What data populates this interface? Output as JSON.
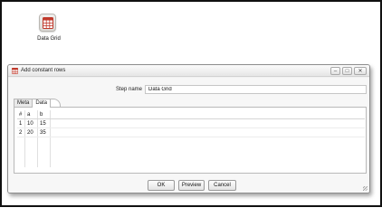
{
  "canvas": {
    "step_label": "Data Grid",
    "step_icon": "data-grid-icon"
  },
  "dialog": {
    "title": "Add constant rows",
    "title_icon": "data-grid-icon",
    "window_buttons": [
      "minimize-icon",
      "maximize-icon",
      "close-icon"
    ],
    "step_name_label": "Step name",
    "step_name_value": "Data Grid",
    "tabs": [
      {
        "label": "Meta",
        "active": false
      },
      {
        "label": "Data",
        "active": true
      }
    ],
    "grid": {
      "columns": [
        "#",
        "a",
        "b"
      ],
      "rows": [
        [
          "1",
          "10",
          "15"
        ],
        [
          "2",
          "20",
          "35"
        ]
      ]
    },
    "buttons": {
      "ok": "OK",
      "preview": "Preview",
      "cancel": "Cancel"
    }
  },
  "colors": {
    "icon_accent": "#c0392b",
    "frame_border": "#111111",
    "dialog_bg": "#f1f1f1"
  }
}
